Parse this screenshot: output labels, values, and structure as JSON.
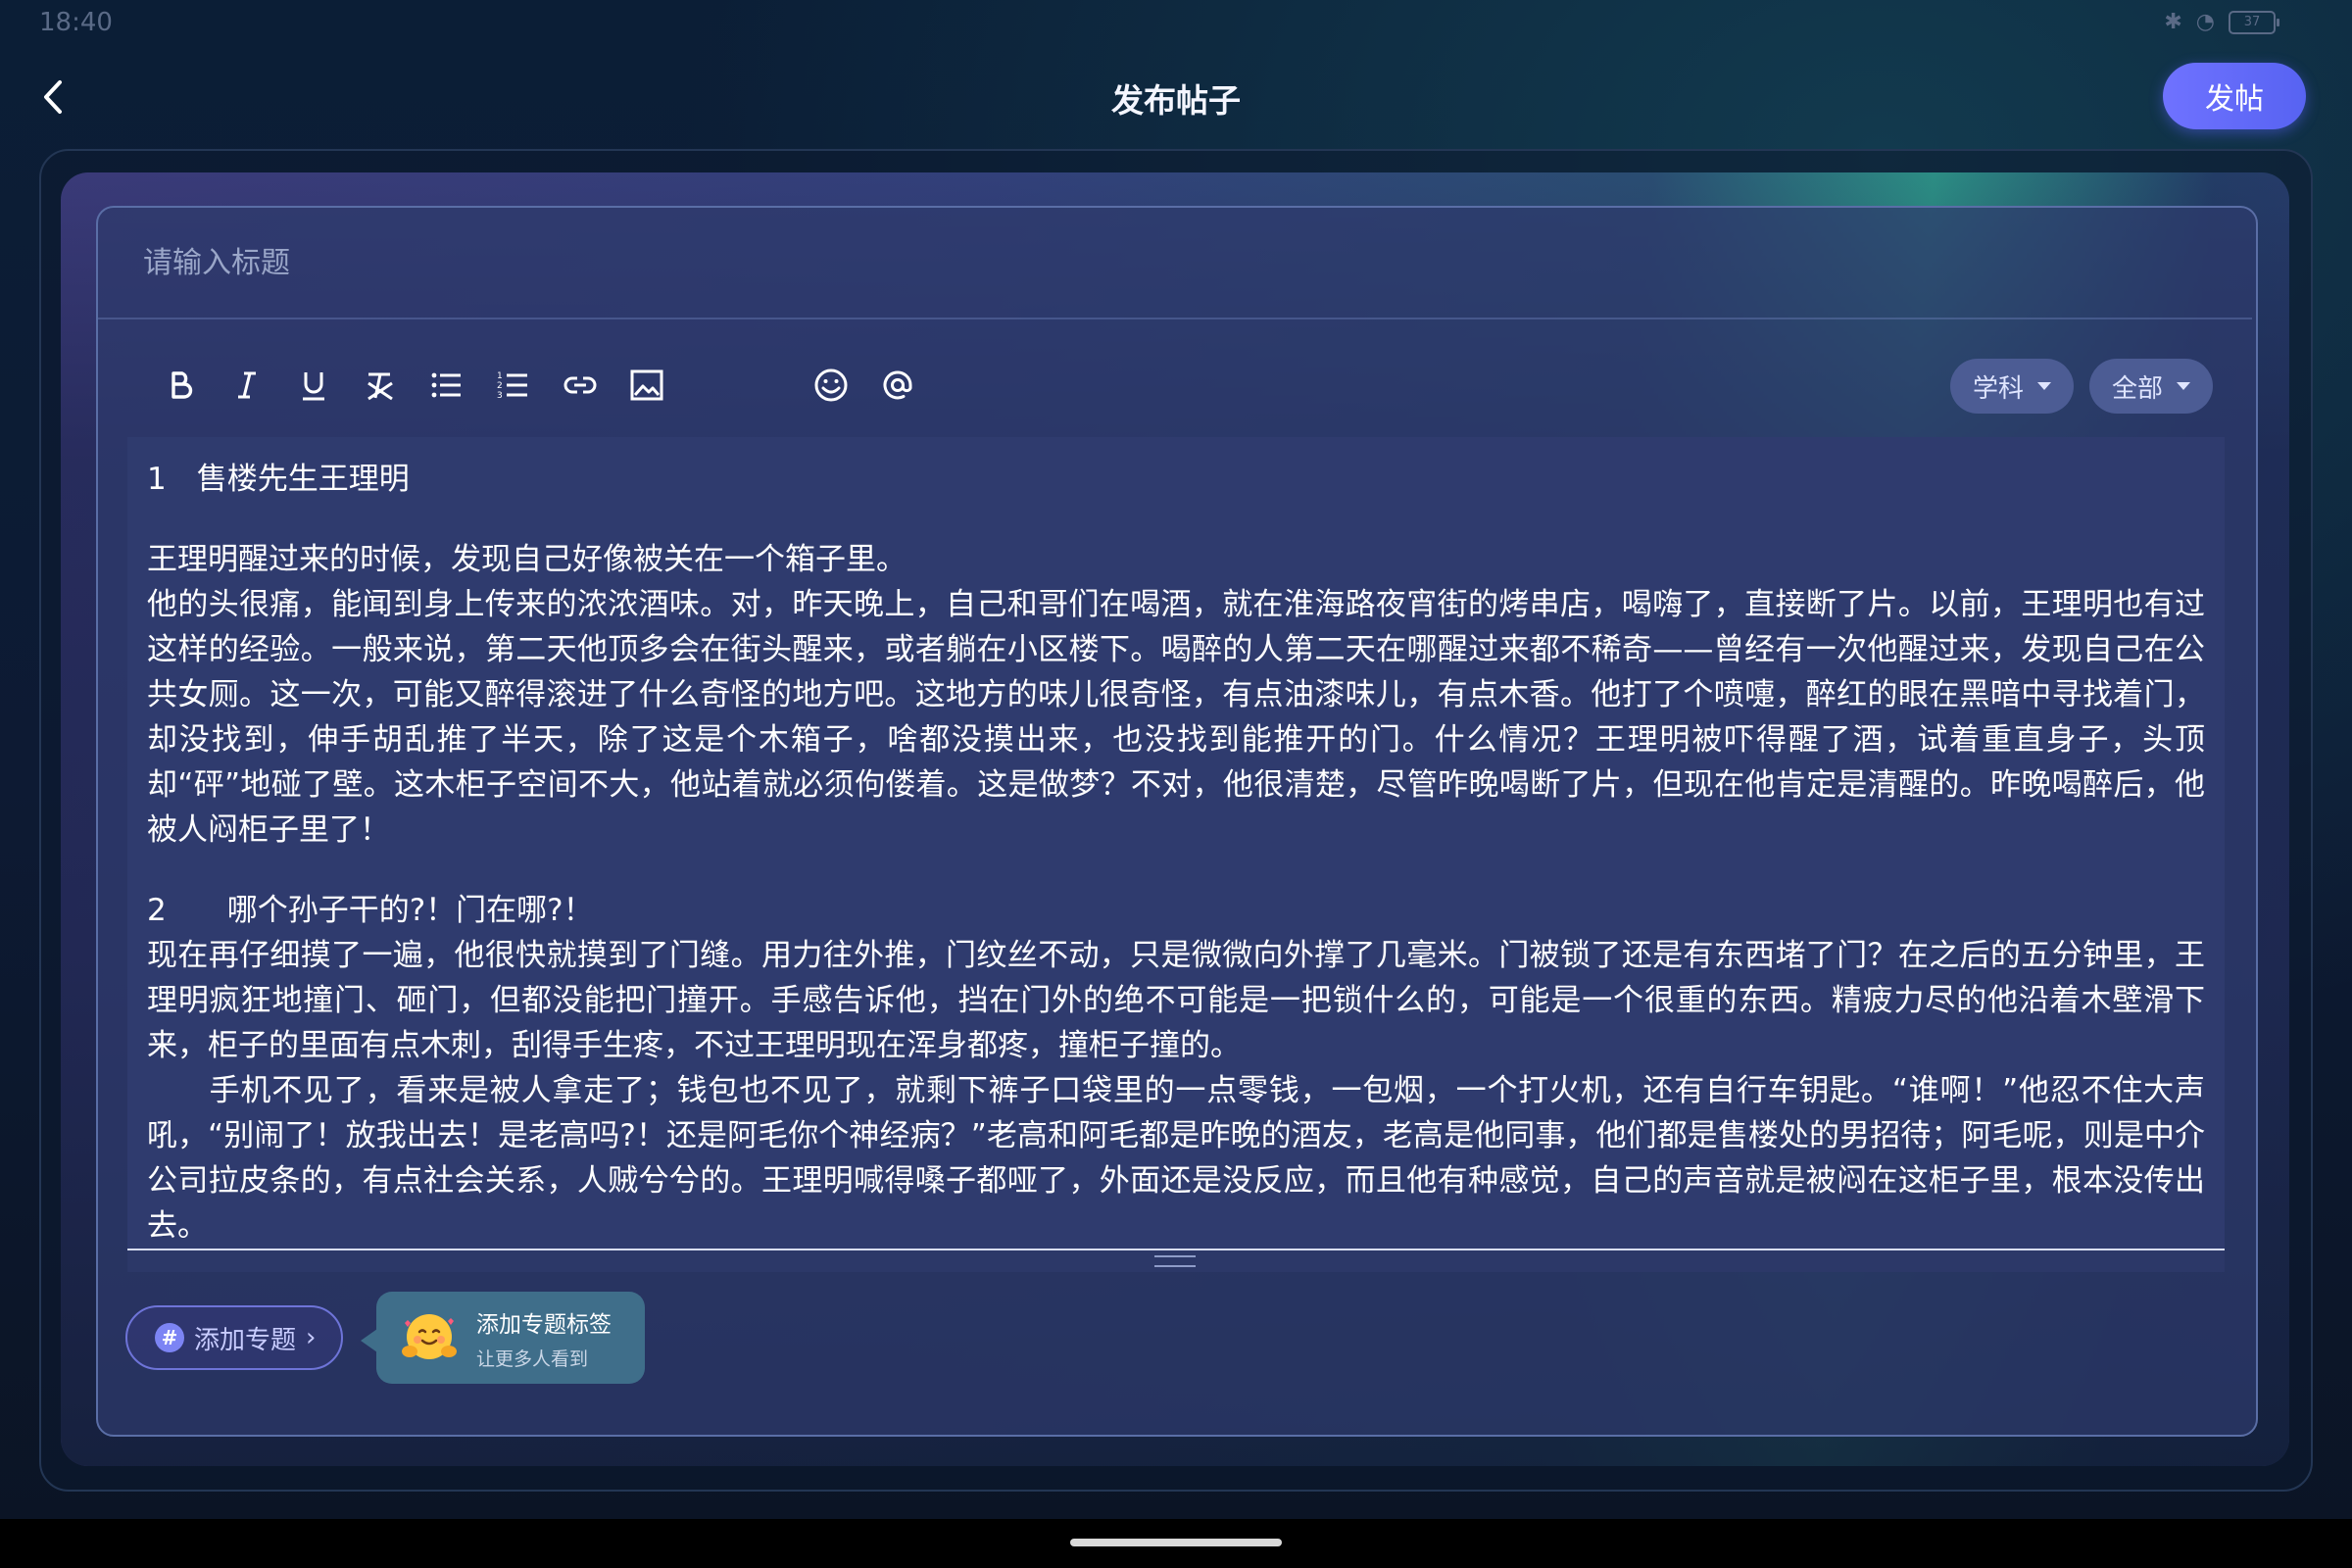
{
  "status_bar": {
    "time": "18:40",
    "battery": "37"
  },
  "header": {
    "title": "发布帖子",
    "publish_label": "发帖"
  },
  "editor": {
    "title_placeholder": "请输入标题",
    "toolbar": [
      "bold-icon",
      "italic-icon",
      "underline-icon",
      "clear-format-icon",
      "bullet-list-icon",
      "numbered-list-icon",
      "link-icon",
      "image-icon",
      "emoji-icon",
      "mention-icon"
    ],
    "subject_dropdown": "学科",
    "scope_dropdown": "全部",
    "content": [
      "1　售楼先生王理明",
      "",
      "王理明醒过来的时候，发现自己好像被关在一个箱子里。",
      "他的头很痛，能闻到身上传来的浓浓酒味。对，昨天晚上，自己和哥们在喝酒，就在淮海路夜宵街的烤串店，喝嗨了，直接断了片。以前，王理明也有过这样的经验。一般来说，第二天他顶多会在街头醒来，或者躺在小区楼下。喝醉的人第二天在哪醒过来都不稀奇——曾经有一次他醒过来，发现自己在公共女厕。这一次，可能又醉得滚进了什么奇怪的地方吧。这地方的味儿很奇怪，有点油漆味儿，有点木香。他打了个喷嚏，醉红的眼在黑暗中寻找着门，却没找到，伸手胡乱推了半天，除了这是个木箱子，啥都没摸出来，也没找到能推开的门。什么情况？王理明被吓得醒了酒，试着重直身子，头顶却“砰”地碰了壁。这木柜子空间不大，他站着就必须佝偻着。这是做梦？不对，他很清楚，尽管昨晚喝断了片，但现在他肯定是清醒的。昨晚喝醉后，他被人闷柜子里了！",
      "",
      "2　　哪个孙子干的?！门在哪?！",
      "现在再仔细摸了一遍，他很快就摸到了门缝。用力往外推，门纹丝不动，只是微微向外撑了几毫米。门被锁了还是有东西堵了门？在之后的五分钟里，王理明疯狂地撞门、砸门，但都没能把门撞开。手感告诉他，挡在门外的绝不可能是一把锁什么的，可能是一个很重的东西。精疲力尽的他沿着木壁滑下来，柜子的里面有点木刺，刮得手生疼，不过王理明现在浑身都疼，撞柜子撞的。",
      "　　手机不见了，看来是被人拿走了；钱包也不见了，就剩下裤子口袋里的一点零钱，一包烟，一个打火机，还有自行车钥匙。“谁啊！”他忍不住大声吼，“别闹了！放我出去！是老高吗?！还是阿毛你个神经病？”老高和阿毛都是昨晚的酒友，老高是他同事，他们都是售楼处的男招待；阿毛呢，则是中介公司拉皮条的，有点社会关系，人贼兮兮的。王理明喊得嗓子都哑了，外面还是没反应，而且他有种感觉，自己的声音就是被闷在这柜子里，根本没传出去。"
    ]
  },
  "footer": {
    "add_topic_label": "添加专题",
    "tip_title": "添加专题标签",
    "tip_subtitle": "让更多人看到"
  }
}
